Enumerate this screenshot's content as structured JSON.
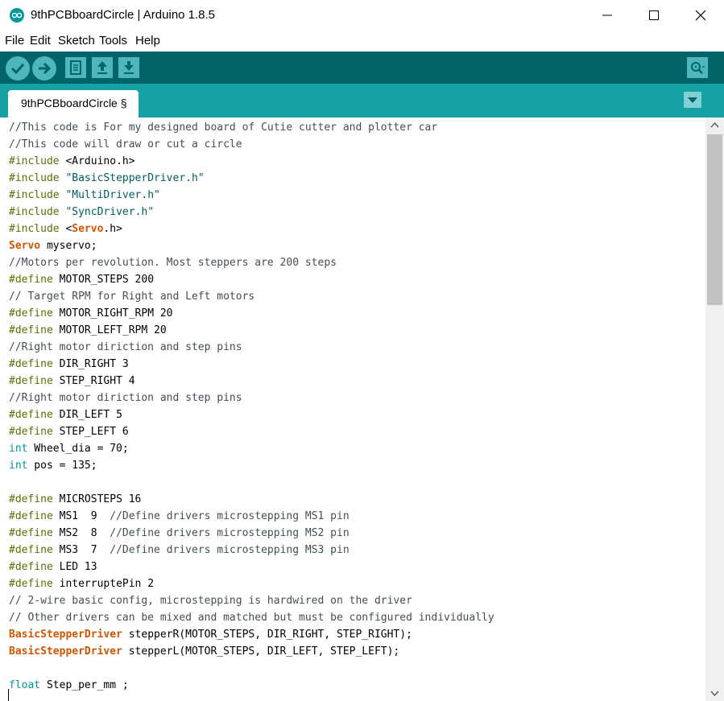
{
  "window": {
    "title": "9thPCBboardCircle | Arduino 1.8.5",
    "icon": "arduino-logo-icon",
    "controls": [
      "minimize-icon",
      "maximize-icon",
      "close-icon"
    ]
  },
  "menu": {
    "file": "File",
    "edit": "Edit",
    "sketch": "Sketch",
    "tools": "Tools",
    "help": "Help"
  },
  "toolbar": {
    "buttons": [
      "verify-icon",
      "upload-icon",
      "new-icon",
      "open-icon",
      "save-icon"
    ],
    "right_button": "serial-monitor-icon"
  },
  "tabs": {
    "active_label": "9thPCBboardCircle §",
    "menu_icon": "tab-menu-icon"
  },
  "colors": {
    "toolbar_bg": "#006468",
    "tabbar_bg": "#17a1a5",
    "button_bg": "#4db7bb",
    "comment": "#434f54",
    "directive": "#5e6d03",
    "string": "#005c5f",
    "type": "#00979c",
    "class": "#d35400"
  },
  "editor": {
    "lines": [
      "//This code is For my designed board of Cutie cutter and plotter car",
      "//This code will draw or cut a circle",
      "#include <Arduino.h>",
      "#include \"BasicStepperDriver.h\"",
      "#include \"MultiDriver.h\"",
      "#include \"SyncDriver.h\"",
      "#include <Servo.h>",
      "Servo myservo;",
      "//Motors per revolution. Most steppers are 200 steps",
      "#define MOTOR_STEPS 200",
      "// Target RPM for Right and Left motors",
      "#define MOTOR_RIGHT_RPM 20",
      "#define MOTOR_LEFT_RPM 20",
      "//Right motor diriction and step pins",
      "#define DIR_RIGHT 3",
      "#define STEP_RIGHT 4",
      "//Right motor diriction and step pins",
      "#define DIR_LEFT 5",
      "#define STEP_LEFT 6",
      "int Wheel_dia = 70;",
      "int pos = 135;",
      "",
      "#define MICROSTEPS 16",
      "#define MS1  9  //Define drivers microstepping MS1 pin",
      "#define MS2  8  //Define drivers microstepping MS2 pin",
      "#define MS3  7  //Define drivers microstepping MS3 pin",
      "#define LED 13",
      "#define interruptePin 2",
      "// 2-wire basic config, microstepping is hardwired on the driver",
      "// Other drivers can be mixed and matched but must be configured individually",
      "BasicStepperDriver stepperR(MOTOR_STEPS, DIR_RIGHT, STEP_RIGHT);",
      "BasicStepperDriver stepperL(MOTOR_STEPS, DIR_LEFT, STEP_LEFT);",
      "",
      "float Step_per_mm ;"
    ]
  }
}
